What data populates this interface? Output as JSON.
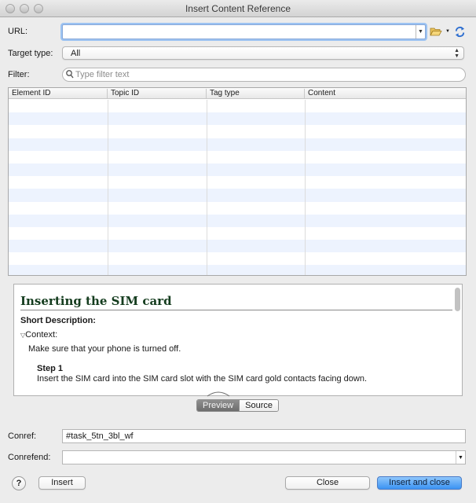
{
  "window": {
    "title": "Insert Content Reference"
  },
  "url": {
    "label": "URL:",
    "value": ""
  },
  "target_type": {
    "label": "Target type:",
    "value": "All"
  },
  "filter": {
    "label": "Filter:",
    "placeholder": "Type filter text"
  },
  "table": {
    "columns": [
      "Element ID",
      "Topic ID",
      "Tag type",
      "Content"
    ],
    "rows": []
  },
  "preview": {
    "title": "Inserting the SIM card",
    "short_description": "Short Description:",
    "context_label": "Context:",
    "context_text": "Make sure that your phone is turned off.",
    "step_label": "Step 1",
    "step_text": "Insert the SIM card into the SIM card slot with the SIM card gold contacts facing down."
  },
  "tabs": {
    "preview": "Preview",
    "source": "Source"
  },
  "conref": {
    "label": "Conref:",
    "value": "#task_5tn_3bl_wf"
  },
  "conrefend": {
    "label": "Conrefend:",
    "value": ""
  },
  "buttons": {
    "help": "?",
    "insert": "Insert",
    "close": "Close",
    "insert_close": "Insert and close"
  },
  "colors": {
    "accent": "#3b93f3",
    "alt_row": "#edf3fe",
    "preview_title": "#143c1e"
  }
}
